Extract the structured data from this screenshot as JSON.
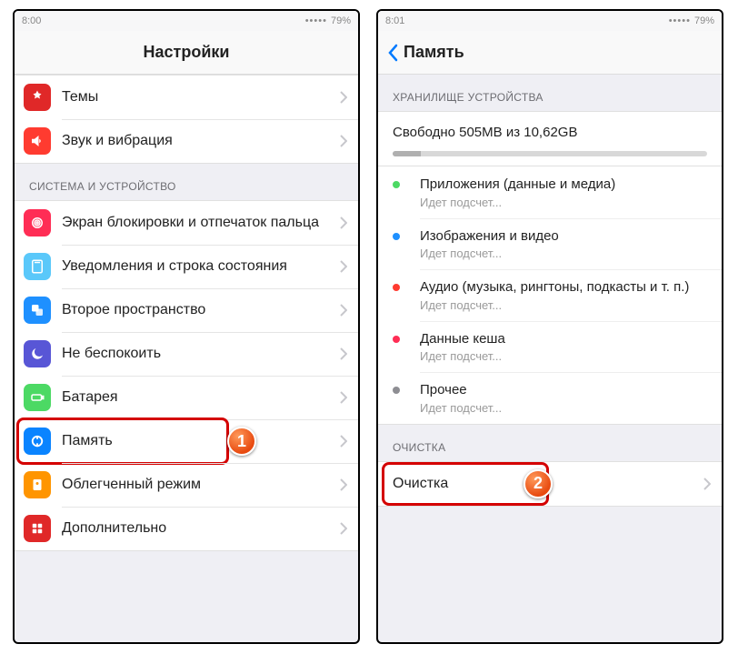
{
  "left": {
    "statusbar": {
      "time": "8:00",
      "battery": "79%"
    },
    "title": "Настройки",
    "group1": [
      {
        "label": "Темы",
        "icon": "themes-icon",
        "bg": "bg-deepred"
      },
      {
        "label": "Звук и вибрация",
        "icon": "sound-icon",
        "bg": "bg-red"
      }
    ],
    "section_system": "СИСТЕМА И УСТРОЙСТВО",
    "group2": [
      {
        "label": "Экран блокировки и отпечаток пальца",
        "icon": "fingerprint-icon",
        "bg": "bg-red2"
      },
      {
        "label": "Уведомления и строка состояния",
        "icon": "notifications-icon",
        "bg": "bg-ltblue"
      },
      {
        "label": "Второе пространство",
        "icon": "second-space-icon",
        "bg": "bg-blue"
      },
      {
        "label": "Не беспокоить",
        "icon": "dnd-icon",
        "bg": "bg-purple"
      },
      {
        "label": "Батарея",
        "icon": "battery-icon",
        "bg": "bg-green"
      },
      {
        "label": "Память",
        "icon": "storage-icon",
        "bg": "bg-blue3"
      },
      {
        "label": "Облегченный режим",
        "icon": "lite-mode-icon",
        "bg": "bg-orange"
      },
      {
        "label": "Дополнительно",
        "icon": "more-icon",
        "bg": "bg-deepred"
      }
    ],
    "badge1": "1"
  },
  "right": {
    "statusbar": {
      "time": "8:01",
      "battery": "79%"
    },
    "back_label": "Память",
    "section_storage": "ХРАНИЛИЩЕ УСТРОЙСТВА",
    "summary": "Свободно 505MB из 10,62GB",
    "fill_percent": 9,
    "categories": [
      {
        "title": "Приложения (данные и медиа)",
        "sub": "Идет подсчет...",
        "color": "#4cd964"
      },
      {
        "title": "Изображения и видео",
        "sub": "Идет подсчет...",
        "color": "#1e90ff"
      },
      {
        "title": "Аудио (музыка, рингтоны, подкасты и т. п.)",
        "sub": "Идет подсчет...",
        "color": "#ff3b30"
      },
      {
        "title": "Данные кеша",
        "sub": "Идет подсчет...",
        "color": "#ff2d55"
      },
      {
        "title": "Прочее",
        "sub": "Идет подсчет...",
        "color": "#8e8e93"
      }
    ],
    "section_cleanup": "ОЧИСТКА",
    "cleanup_label": "Очистка",
    "badge2": "2"
  }
}
